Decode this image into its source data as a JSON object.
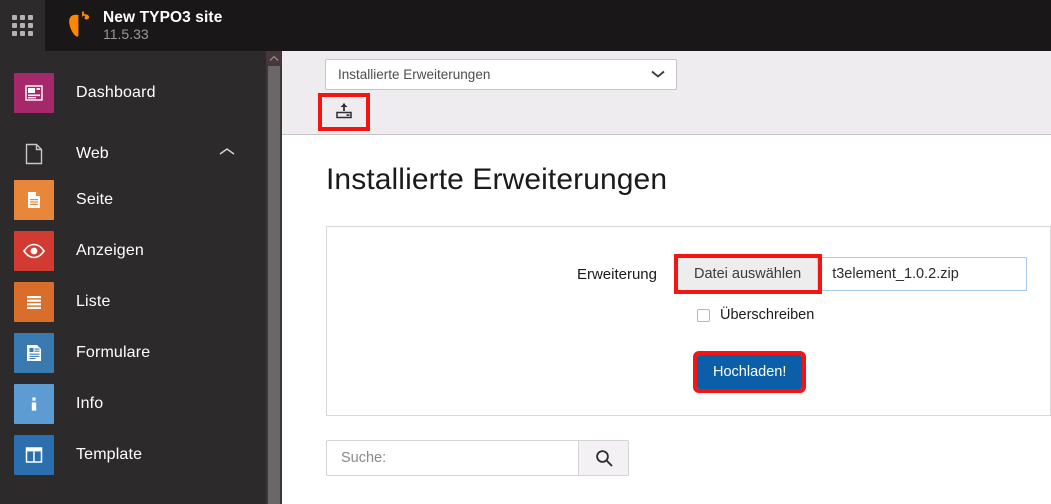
{
  "topbar": {
    "grid_icon": "grid-menu-icon",
    "logo_icon": "typo3-logo",
    "site_name": "New TYPO3 site",
    "version": "11.5.33",
    "logo_color": "#ff8700",
    "background": "#1a1719"
  },
  "sidebar": {
    "background": "#2c2a2b",
    "items": [
      {
        "label": "Dashboard",
        "icon": "dashboard-icon",
        "color": "#a4286a"
      },
      {
        "label": "Seite",
        "icon": "page-icon",
        "color": "#e8873a"
      },
      {
        "label": "Anzeigen",
        "icon": "eye-icon",
        "color": "#d13b32"
      },
      {
        "label": "Liste",
        "icon": "list-icon",
        "color": "#d96e2a"
      },
      {
        "label": "Formulare",
        "icon": "form-icon",
        "color": "#3b7ab0"
      },
      {
        "label": "Info",
        "icon": "info-icon",
        "color": "#5d9cd3"
      },
      {
        "label": "Template",
        "icon": "template-icon",
        "color": "#2b6fae"
      }
    ],
    "group": {
      "label": "Web",
      "icon": "page-outline-icon",
      "chevron": "chevron-up-icon",
      "expanded": true
    },
    "scrollbar": {
      "arrow": "scroll-up-arrow-icon"
    }
  },
  "docheader": {
    "background": "#eeecef",
    "module_select": {
      "value": "Installierte Erweiterungen",
      "chevron": "chevron-down-icon"
    },
    "upload_button": {
      "icon": "upload-tray-icon",
      "highlighted": true,
      "highlight_color": "#f41414"
    }
  },
  "main": {
    "page_title": "Installierte Erweiterungen",
    "form": {
      "field_label": "Erweiterung",
      "file_browse_label": "Datei auswählen",
      "file_name": "t3element_1.0.2.zip",
      "file_browse_highlighted": true,
      "checkbox": {
        "label": "Überschreiben",
        "checked": false
      },
      "submit_label": "Hochladen!",
      "submit_color": "#0a5fa8",
      "submit_highlighted": true
    },
    "search": {
      "placeholder": "Suche:",
      "value": "",
      "button_icon": "search-icon"
    }
  }
}
